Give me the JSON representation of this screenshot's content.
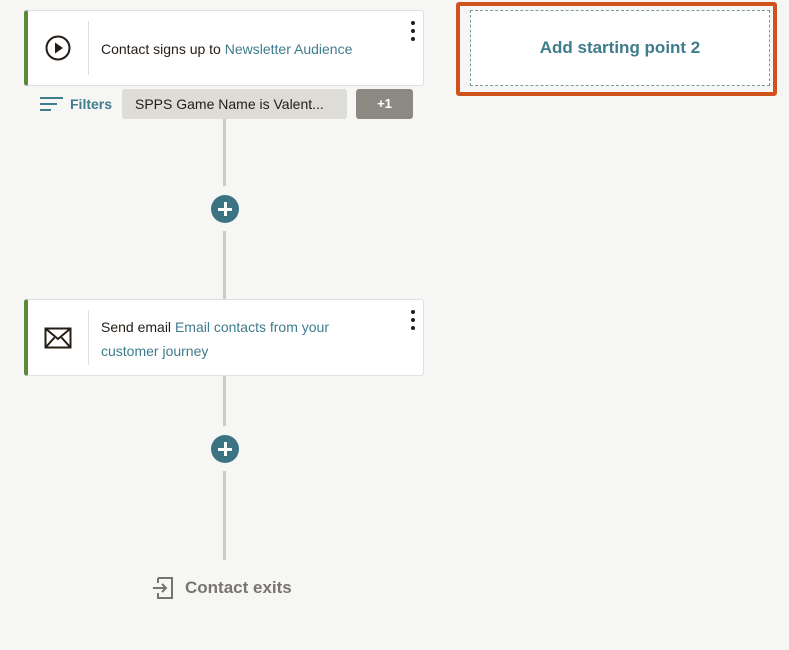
{
  "trigger_card": {
    "icon": "play-circle-icon",
    "prefix": "Contact signs up to",
    "audience": "Newsletter Audience"
  },
  "filters": {
    "label": "Filters",
    "chip": "SPPS Game Name is Valent...",
    "more": "+1"
  },
  "email_card": {
    "icon": "envelope-icon",
    "prefix": "Send email",
    "detail": "Email contacts from your customer journey"
  },
  "exit": {
    "icon": "exit-icon",
    "label": "Contact exits"
  },
  "starting_point_2": {
    "label": "Add starting point 2"
  },
  "colors": {
    "accent_teal": "#3c7382",
    "card_border_green": "#5a8a3a",
    "highlight_orange": "#d0531c"
  }
}
